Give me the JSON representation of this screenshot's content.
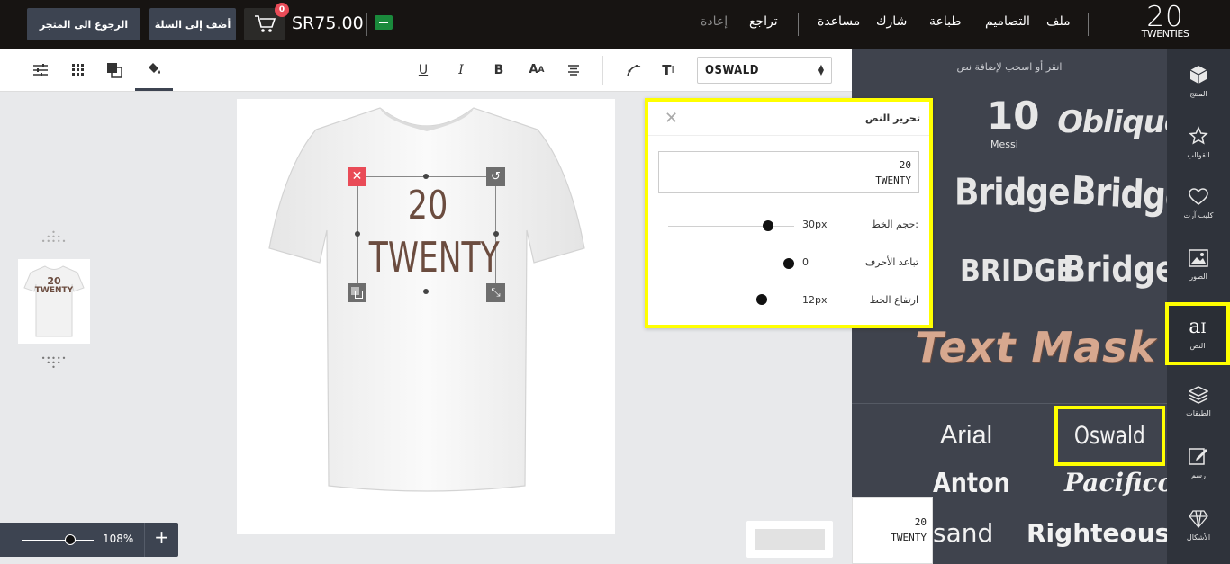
{
  "topbar": {
    "logo_number": "20",
    "logo_word": "TWENTIES",
    "menu": [
      "ملف",
      "التصاميم",
      "طباعة",
      "شارك",
      "مساعدة",
      "تراجع",
      "إعادة"
    ],
    "price": "SR75.00",
    "cart_count": "0",
    "add_to_cart": "أضف إلى السلة",
    "back_to_store": "الرجوع الى المتجر"
  },
  "colors": {
    "topbar_bg": "#171412",
    "panel_bg": "#3f434d",
    "highlight": "#ffff00",
    "delete_red": "#e94b57",
    "shirt_text": "#6b4c3f"
  },
  "toolbar": {
    "font_select": "OSWALD",
    "icons": [
      "underline-icon",
      "italic-icon",
      "bold-icon",
      "font-size-icon",
      "align-icon",
      "curve-text-icon",
      "text-icon",
      "fill-icon",
      "color-square-icon",
      "grid-icon",
      "sliders-icon"
    ]
  },
  "sidebar": {
    "items": [
      {
        "label": "المنتج",
        "icon": "cube-icon"
      },
      {
        "label": "القوالب",
        "icon": "star-icon"
      },
      {
        "label": "كليب آرت",
        "icon": "heart-icon"
      },
      {
        "label": "الصور",
        "icon": "image-icon"
      },
      {
        "label": "النص",
        "icon": "text-icon"
      },
      {
        "label": "الطبقات",
        "icon": "layers-icon"
      },
      {
        "label": "رسم",
        "icon": "pencil-icon"
      },
      {
        "label": "الأشكال",
        "icon": "diamond-icon"
      }
    ]
  },
  "textpanel": {
    "hint": "انقر أو اسحب لإضافة نص",
    "styles": [
      "10",
      "Messi",
      "Oblique",
      "Bridge",
      "Bridge",
      "BRIDGE",
      "Bridge",
      "Text Mask"
    ],
    "fonts": [
      "Arial",
      "Oswald",
      "Anton",
      "Pacifico",
      "sand",
      "Righteous"
    ],
    "preview_line1": "20",
    "preview_line2": "TWENTY"
  },
  "canvas": {
    "line1": "20",
    "line2": "TWENTY",
    "thumb_line1": "20",
    "thumb_line2": "TWENTY"
  },
  "popup": {
    "title": "تحرير النص",
    "text_line1": "20",
    "text_line2": "TWENTY",
    "font_size_label": "حجم الخط:",
    "font_size_value": "30px",
    "font_size_level": 0.79,
    "letter_spacing_label": "تباعد الأحرف",
    "letter_spacing_value": "0",
    "letter_spacing_level": 0.96,
    "line_height_label": "ارتفاع الخط",
    "line_height_value": "12px",
    "line_height_level": 0.74
  },
  "zoom": {
    "value": "108%",
    "level": 0.68,
    "plus": "+"
  }
}
